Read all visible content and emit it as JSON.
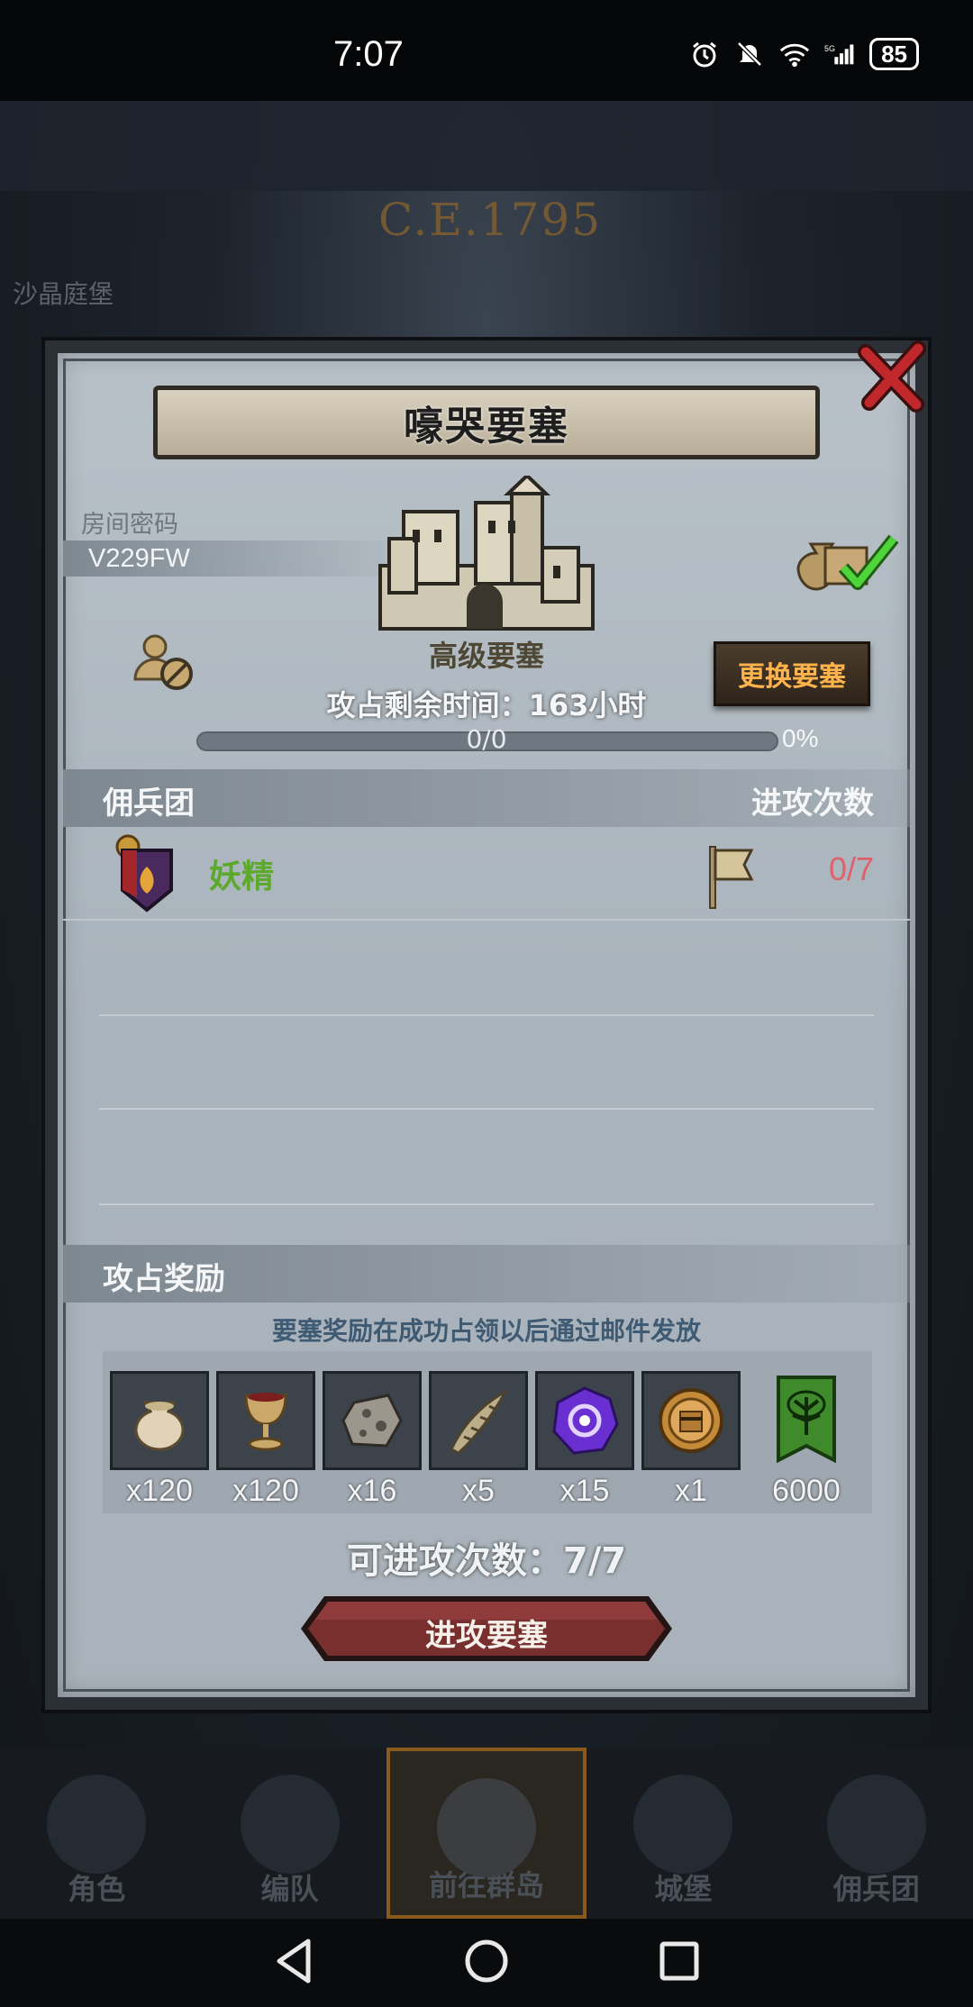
{
  "status_bar": {
    "time": "7:07",
    "battery": "85",
    "icons": [
      "alarm-icon",
      "mute-icon",
      "wifi-icon",
      "signal-5g-icon"
    ]
  },
  "background": {
    "era": "C.E.1795",
    "location": "沙晶庭堡"
  },
  "dialog": {
    "title": "嚎哭要塞",
    "room_label": "房间密码",
    "room_code": "V229FW",
    "fort_level": "高级要塞",
    "time_left": "攻占剩余时间：163小时",
    "change_button": "更换要塞",
    "progress": {
      "count": "0/0",
      "percent": "0%",
      "fraction": 0
    },
    "mercenary_header": "佣兵团",
    "attacks_header": "进攻次数",
    "mercenaries": [
      {
        "name": "妖精",
        "attacks": "0/7"
      }
    ],
    "rewards_header": "攻占奖励",
    "reward_note": "要塞奖励在成功占领以后通过邮件发放",
    "rewards": [
      {
        "icon": "sack-icon",
        "qty": "x120"
      },
      {
        "icon": "chalice-icon",
        "qty": "x120"
      },
      {
        "icon": "ore-icon",
        "qty": "x16"
      },
      {
        "icon": "horn-icon",
        "qty": "x5"
      },
      {
        "icon": "purple-crystal-icon",
        "qty": "x15"
      },
      {
        "icon": "knight-medal-icon",
        "qty": "x1"
      },
      {
        "icon": "tree-banner-icon",
        "qty": "6000"
      }
    ],
    "attempts": "可进攻次数：7/7",
    "attack_button": "进攻要塞"
  },
  "tabs": [
    {
      "label": "角色",
      "active": false
    },
    {
      "label": "编队",
      "active": false
    },
    {
      "label": "前往群岛",
      "active": true
    },
    {
      "label": "城堡",
      "active": false
    },
    {
      "label": "佣兵团",
      "active": false
    }
  ],
  "colors": {
    "accent_orange": "#ffb34d",
    "mercenary_green": "#5da92c",
    "attack_red": "#e0606b",
    "button_red": "#7a2f2f"
  }
}
